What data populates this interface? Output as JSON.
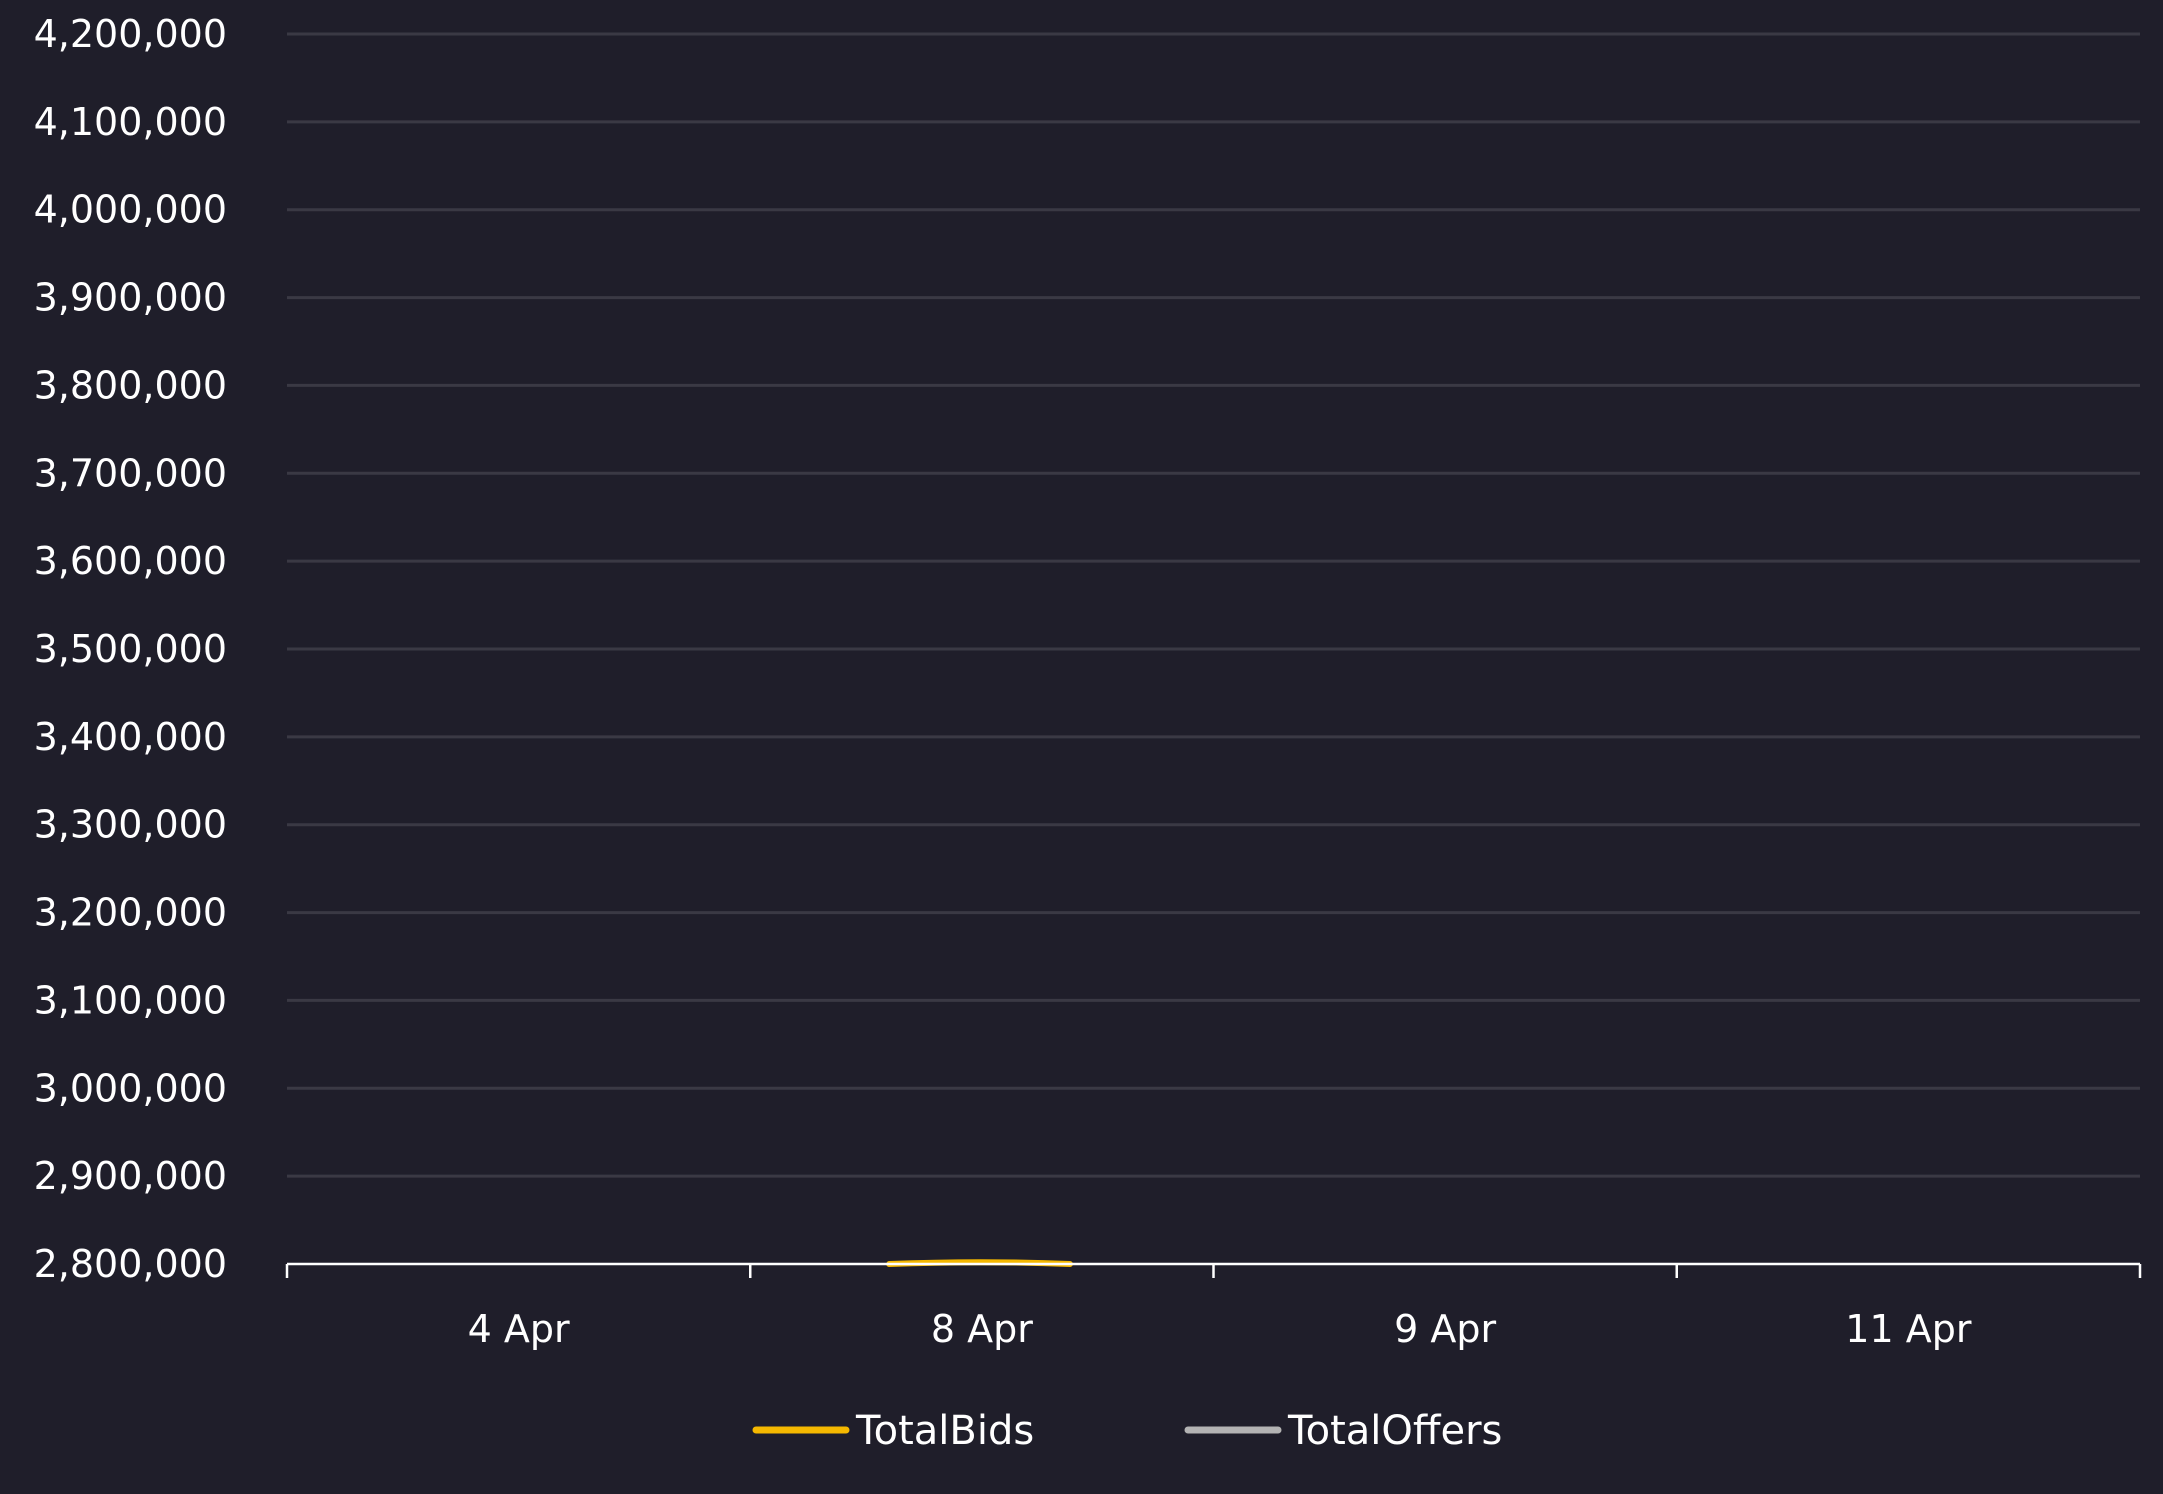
{
  "chart_data": {
    "type": "line",
    "x": [
      "4 Apr",
      "8 Apr",
      "9 Apr",
      "11 Apr"
    ],
    "ylim": [
      2800000,
      4200000
    ],
    "y_ticks": [
      "4,200,000",
      "4,100,000",
      "4,000,000",
      "3,900,000",
      "3,800,000",
      "3,700,000",
      "3,600,000",
      "3,500,000",
      "3,400,000",
      "3,300,000",
      "3,200,000",
      "3,100,000",
      "3,000,000",
      "2,900,000",
      "2,800,000"
    ],
    "y_tick_values": [
      4200000,
      4100000,
      4000000,
      3900000,
      3800000,
      3700000,
      3600000,
      3500000,
      3400000,
      3300000,
      3200000,
      3100000,
      3000000,
      2900000,
      2800000
    ],
    "grid": true,
    "legend_position": "bottom-center",
    "series": [
      {
        "name": "TotalBids",
        "color": "#f5b800",
        "values": [
          null,
          2802500,
          null,
          null
        ]
      },
      {
        "name": "TotalOffers",
        "color": "#b3b3b3",
        "values": [
          null,
          null,
          null,
          null
        ]
      }
    ]
  }
}
